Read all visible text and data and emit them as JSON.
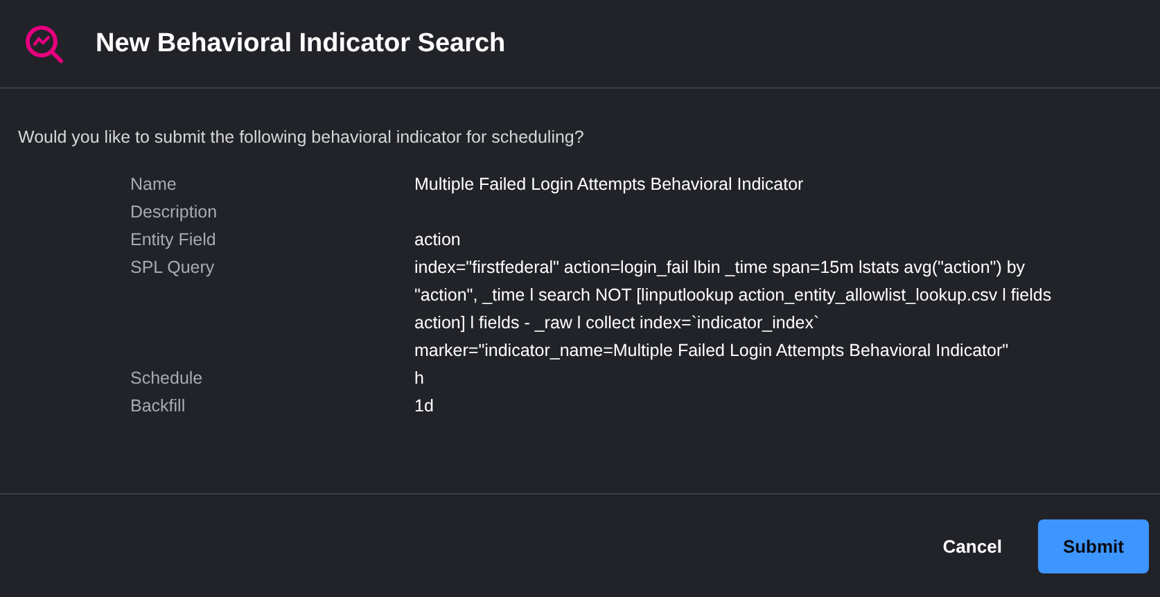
{
  "dialog": {
    "title": "New Behavioral Indicator Search"
  },
  "prompt": "Would you like to submit the following behavioral indicator for scheduling?",
  "details": [
    {
      "label": "Name",
      "value": "Multiple Failed Login Attempts Behavioral Indicator"
    },
    {
      "label": "Description"
    },
    {
      "label": "Entity Field",
      "value": "action"
    },
    {
      "label": "SPL Query",
      "value": "index=\"firstfederal\" action=login_fail lbin _time span=15m lstats avg(\"action\") by \"action\", _time l search NOT [linputlookup action_entity_allowlist_lookup.csv l fields action] l fields - _raw l collect index=`indicator_index` marker=\"indicator_name=Multiple Failed Login Attempts Behavioral Indicator\""
    },
    {
      "label": "Schedule",
      "value": "h"
    },
    {
      "label": "Backfill",
      "value": "1d"
    }
  ],
  "buttons": [
    {
      "label": "Cancel",
      "kind": "secondary"
    },
    {
      "label": "Submit",
      "kind": "primary"
    }
  ]
}
